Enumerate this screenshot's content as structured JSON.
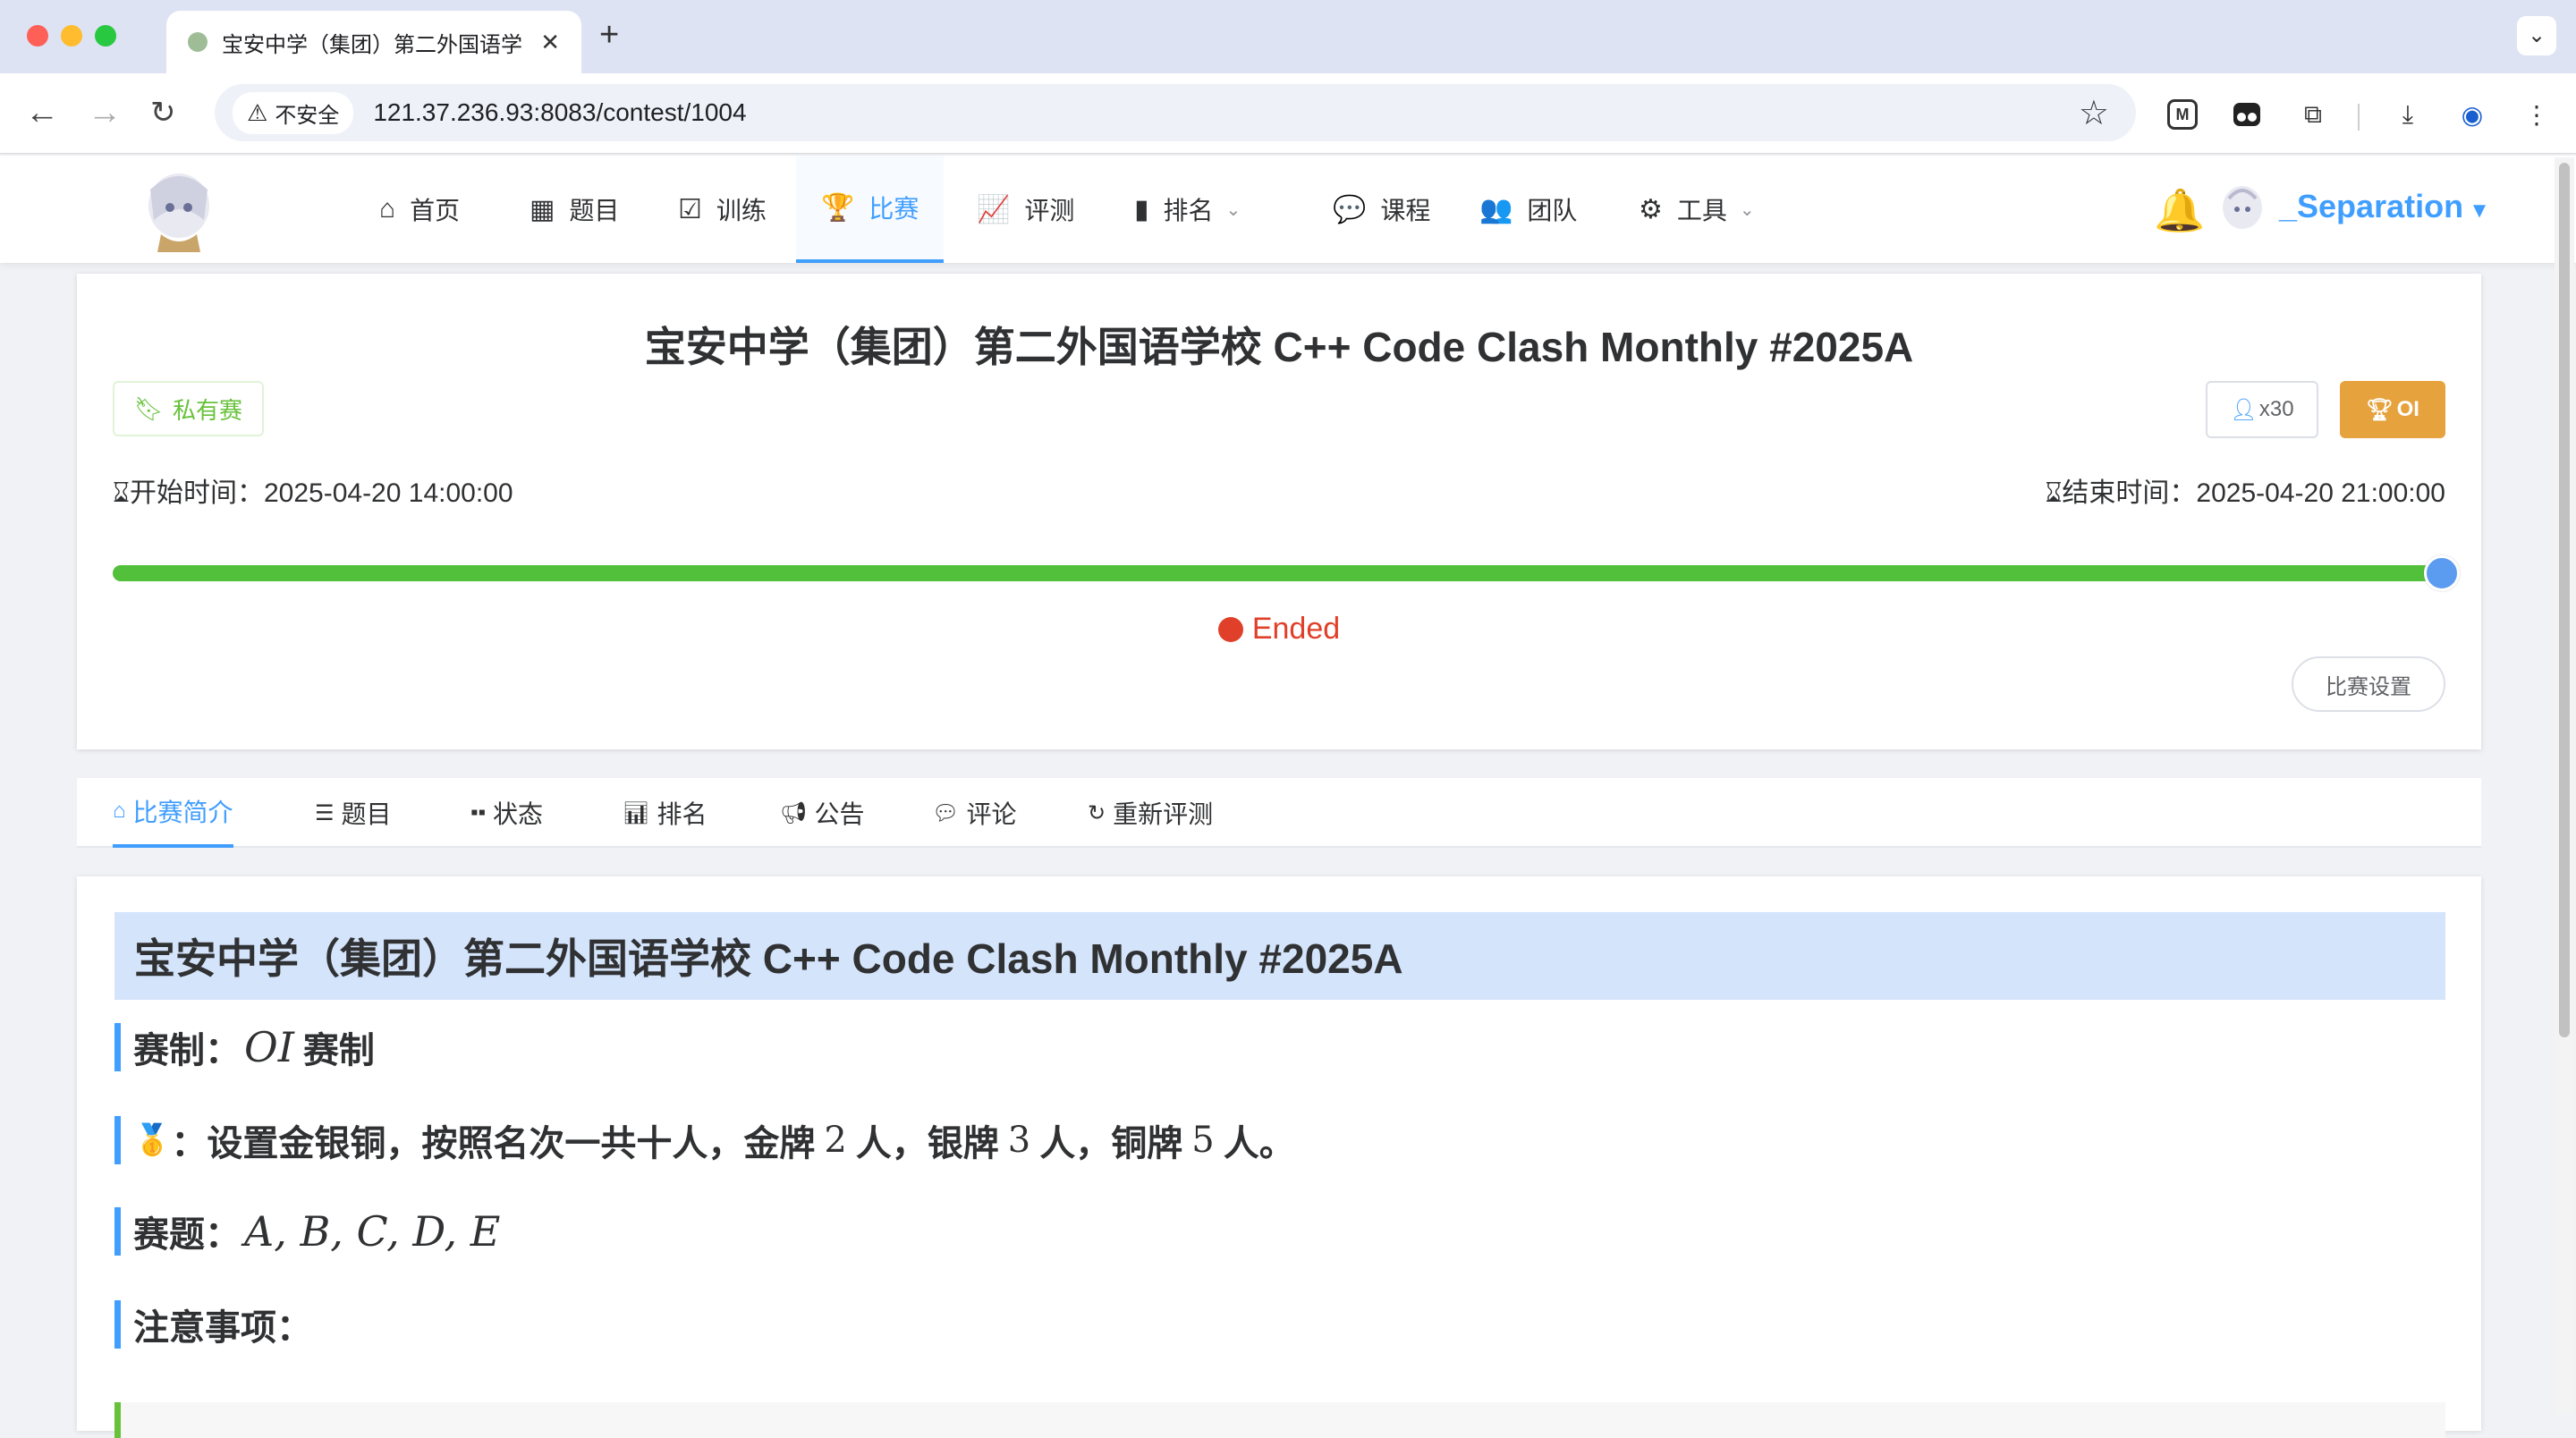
{
  "browser": {
    "tab_title": "宝安中学（集团）第二外国语学",
    "tab_close": "✕",
    "new_tab": "+",
    "security_label": "不安全",
    "url": "121.37.236.93:8083/contest/1004"
  },
  "nav": {
    "items": [
      {
        "label": "首页",
        "icon": "home-icon"
      },
      {
        "label": "题目",
        "icon": "grid-icon"
      },
      {
        "label": "训练",
        "icon": "clipboard-check-icon"
      },
      {
        "label": "比赛",
        "icon": "trophy-icon",
        "active": true
      },
      {
        "label": "评测",
        "icon": "chart-line-icon"
      },
      {
        "label": "排名",
        "icon": "bar-chart-icon",
        "dropdown": true
      },
      {
        "label": "课程",
        "icon": "comment-icon"
      },
      {
        "label": "团队",
        "icon": "users-icon"
      },
      {
        "label": "工具",
        "icon": "gear-icon",
        "dropdown": true
      }
    ],
    "username": "_Separation"
  },
  "contest": {
    "title": "宝安中学（集团）第二外国语学校 C++ Code Clash Monthly #2025A",
    "private_label": "私有赛",
    "participants": "x30",
    "rule_type": "OI",
    "start_label": "开始时间：",
    "start_time": "2025-04-20 14:00:00",
    "end_label": "结束时间：",
    "end_time": "2025-04-20 21:00:00",
    "progress_percent": 100,
    "status": "Ended",
    "settings_label": "比赛设置"
  },
  "tabs": [
    {
      "label": "比赛简介",
      "icon": "home-icon",
      "active": true
    },
    {
      "label": "题目",
      "icon": "list-icon"
    },
    {
      "label": "状态",
      "icon": "grid-icon"
    },
    {
      "label": "排名",
      "icon": "bar-chart-icon"
    },
    {
      "label": "公告",
      "icon": "megaphone-icon"
    },
    {
      "label": "评论",
      "icon": "comment-icon"
    },
    {
      "label": "重新评测",
      "icon": "refresh-icon"
    }
  ],
  "description": {
    "title": "宝安中学（集团）第二外国语学校 C++ Code Clash Monthly #2025A",
    "format_prefix": "赛制：",
    "format_math": "OI",
    "format_suffix": "赛制",
    "medal_icon": "🥇",
    "medal_a": "：设置金银铜，按照名次一共十人，金牌",
    "medal_n1": "2",
    "medal_b": "人，银牌",
    "medal_n2": "3",
    "medal_c": "人，铜牌",
    "medal_n3": "5",
    "medal_d": "人。",
    "problems_prefix": "赛题：",
    "problems_math": "A, B, C, D, E",
    "notes_label": "注意事项："
  },
  "colors": {
    "primary": "#409eff",
    "success": "#52c03a",
    "warning": "#e6a23c",
    "danger": "#e0402a"
  }
}
